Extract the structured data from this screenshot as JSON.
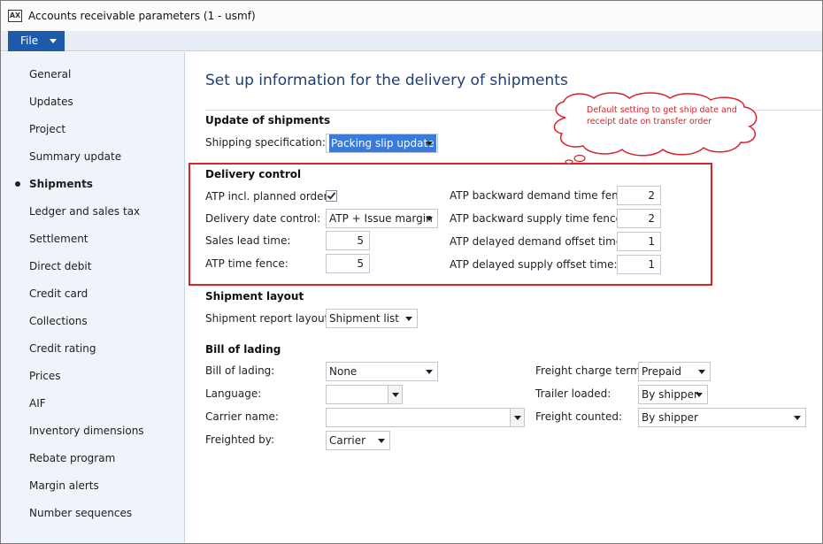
{
  "window": {
    "title": "Accounts receivable parameters (1 - usmf)",
    "icon_text": "AX"
  },
  "menu": {
    "file_label": "File"
  },
  "sidebar": {
    "items": [
      {
        "label": "General"
      },
      {
        "label": "Updates"
      },
      {
        "label": "Project"
      },
      {
        "label": "Summary update"
      },
      {
        "label": "Shipments",
        "active": true
      },
      {
        "label": "Ledger and sales tax"
      },
      {
        "label": "Settlement"
      },
      {
        "label": "Direct debit"
      },
      {
        "label": "Credit card"
      },
      {
        "label": "Collections"
      },
      {
        "label": "Credit rating"
      },
      {
        "label": "Prices"
      },
      {
        "label": "AIF"
      },
      {
        "label": "Inventory dimensions"
      },
      {
        "label": "Rebate program"
      },
      {
        "label": "Margin alerts"
      },
      {
        "label": "Number sequences"
      }
    ]
  },
  "main": {
    "title": "Set up information for the delivery of shipments",
    "callout": "Default setting to get ship date and receipt date on transfer order",
    "update_of_shipments": {
      "heading": "Update of shipments",
      "shipping_specification_label": "Shipping specification:",
      "shipping_specification_value": "Packing slip update"
    },
    "delivery_control": {
      "heading": "Delivery control",
      "atp_incl_planned_orders_label": "ATP incl. planned orders:",
      "atp_incl_planned_orders_checked": true,
      "delivery_date_control_label": "Delivery date control:",
      "delivery_date_control_value": "ATP + Issue margin",
      "sales_lead_time_label": "Sales lead time:",
      "sales_lead_time_value": "5",
      "atp_time_fence_label": "ATP time fence:",
      "atp_time_fence_value": "5",
      "atp_backward_demand_label": "ATP backward demand time fence:",
      "atp_backward_demand_value": "2",
      "atp_backward_supply_label": "ATP backward supply time fence:",
      "atp_backward_supply_value": "2",
      "atp_delayed_demand_label": "ATP delayed demand offset time:",
      "atp_delayed_demand_value": "1",
      "atp_delayed_supply_label": "ATP delayed supply offset time:",
      "atp_delayed_supply_value": "1"
    },
    "shipment_layout": {
      "heading": "Shipment layout",
      "shipment_report_layout_label": "Shipment report layout:",
      "shipment_report_layout_value": "Shipment list"
    },
    "bill_of_lading": {
      "heading": "Bill of lading",
      "bill_of_lading_label": "Bill of lading:",
      "bill_of_lading_value": "None",
      "language_label": "Language:",
      "language_value": "",
      "carrier_name_label": "Carrier name:",
      "carrier_name_value": "",
      "freighted_by_label": "Freighted by:",
      "freighted_by_value": "Carrier",
      "freight_charge_terms_label": "Freight charge terms:",
      "freight_charge_terms_value": "Prepaid",
      "trailer_loaded_label": "Trailer loaded:",
      "trailer_loaded_value": "By shipper",
      "freight_counted_label": "Freight counted:",
      "freight_counted_value": "By shipper"
    }
  },
  "colors": {
    "accent": "#1e5bad",
    "title_blue": "#1c3f74",
    "highlight_red": "#d8232a",
    "sidebar_bg": "#eef4fa"
  }
}
